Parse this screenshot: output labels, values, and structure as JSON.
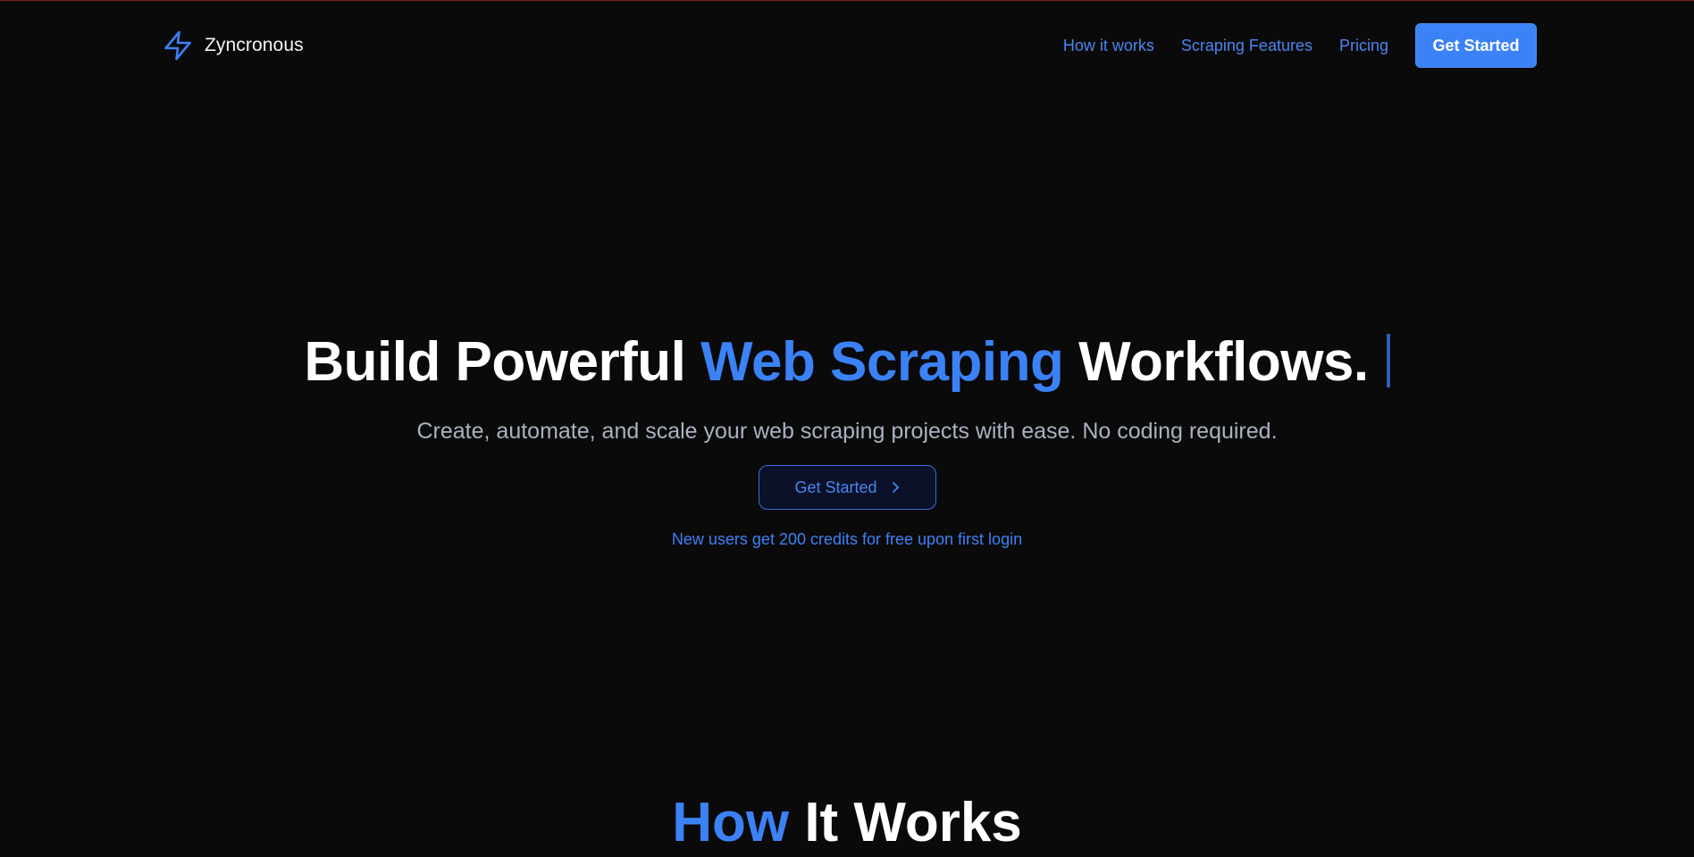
{
  "colors": {
    "background": "#0b0a0a",
    "accent": "#3b82f6",
    "muted_text": "#a8b2c1",
    "top_border": "#7a1e24"
  },
  "header": {
    "logo_icon": "lightning-bolt-icon",
    "brand": "Zyncronous",
    "nav": {
      "how_it_works": "How it works",
      "scraping_features": "Scraping Features",
      "pricing": "Pricing"
    },
    "cta_label": "Get Started"
  },
  "hero": {
    "title_part1": "Build Powerful ",
    "title_accent": "Web Scraping",
    "title_part2": " Workflows.",
    "subtitle": "Create, automate, and scale your web scraping projects with ease. No coding required.",
    "cta_label": "Get Started",
    "cta_icon": "chevron-right-icon",
    "note": "New users get 200 credits for free upon first login"
  },
  "next_section": {
    "title_accent": "How",
    "title_rest": " It Works"
  }
}
